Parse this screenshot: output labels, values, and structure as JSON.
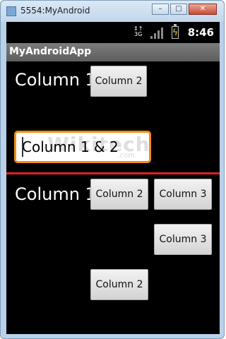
{
  "window": {
    "title": "5554:MyAndroid",
    "controls": {
      "minimize": "–",
      "maximize": "□",
      "close": "✕"
    }
  },
  "statusbar": {
    "network_top": "↕↑",
    "network_label": "3G",
    "time": "8:46"
  },
  "app": {
    "title": "MyAndroidApp"
  },
  "row1": {
    "label": "Column 1",
    "button": "Column 2"
  },
  "edit": {
    "value": "Column 1 & 2",
    "watermark": "Wikitechy",
    "watermark_sub": ".com"
  },
  "row3": {
    "label": "Column 1",
    "button_col2": "Column 2",
    "button_col3": "Column 3"
  },
  "row4": {
    "button_col3": "Column 3"
  },
  "row5": {
    "button_col2": "Column 2"
  },
  "colors": {
    "accent_orange": "#f28b14",
    "divider_red": "#e02020",
    "battery_bolt": "#f3d11f"
  },
  "icons": [
    "app-window-icon",
    "3g-icon",
    "signal-icon",
    "battery-charging-icon"
  ]
}
